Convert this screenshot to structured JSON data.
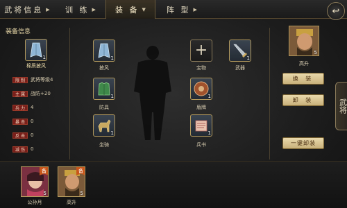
{
  "tabs": [
    {
      "label": "武将信息",
      "active": false
    },
    {
      "label": "训 练",
      "active": false
    },
    {
      "label": "装 备",
      "active": true
    },
    {
      "label": "阵 型",
      "active": false
    }
  ],
  "left": {
    "title": "装备信息",
    "item_name": "棉质披风",
    "item_count": "1",
    "stats": [
      {
        "tag": "限 制",
        "value": "武将等级4"
      },
      {
        "tag": "主 属",
        "value": "战防+20"
      },
      {
        "tag": "兵 力",
        "value": "4"
      },
      {
        "tag": "暴 击",
        "value": "0"
      },
      {
        "tag": "反 击",
        "value": "0"
      },
      {
        "tag": "减 伤",
        "value": "0"
      }
    ]
  },
  "slots": [
    {
      "label": "披风",
      "count": "1"
    },
    {
      "label": "防具",
      "count": "1"
    },
    {
      "label": "坐骑",
      "count": "1"
    },
    {
      "label": "宝物",
      "count": ""
    },
    {
      "label": "盾牌",
      "count": "1"
    },
    {
      "label": "兵书",
      "count": "1"
    },
    {
      "label": "武器",
      "count": "1"
    }
  ],
  "hero": {
    "name": "高升",
    "level": "5"
  },
  "buttons": {
    "change": "换 装",
    "remove": "卸 装",
    "remove_all": "一键卸装"
  },
  "side_tab": "武将",
  "roster": [
    {
      "name": "公孙月",
      "level": "5",
      "badge": "备"
    },
    {
      "name": "高升",
      "level": "5",
      "badge": "备"
    }
  ]
}
